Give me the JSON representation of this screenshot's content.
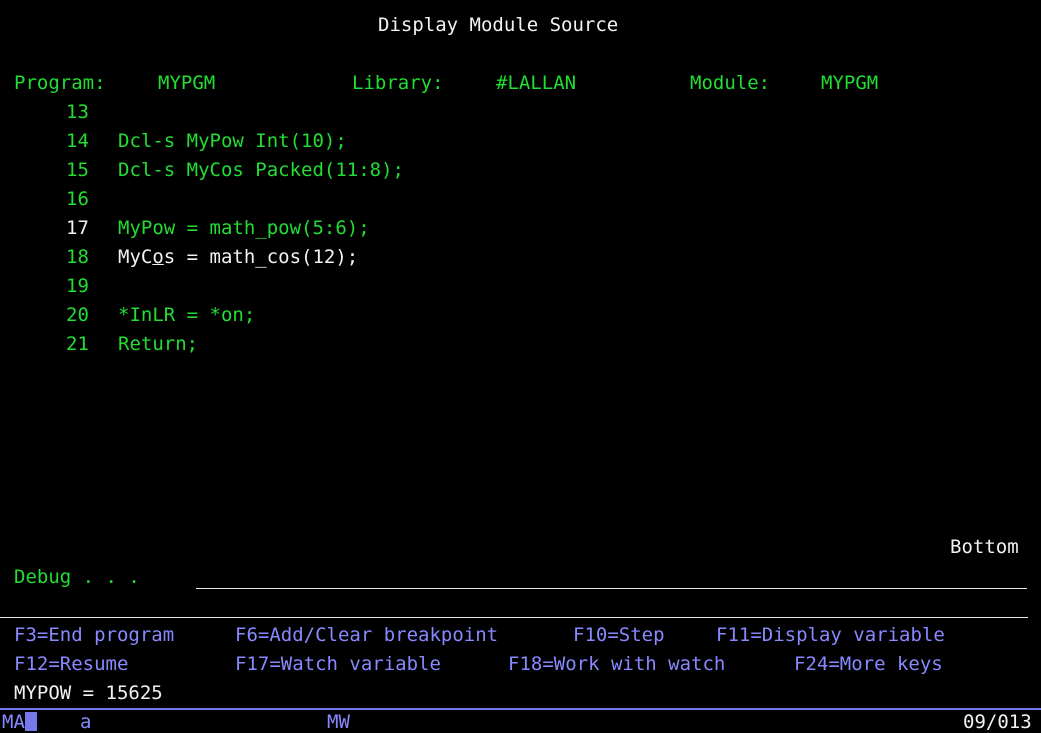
{
  "screen": {
    "title": "Display Module Source"
  },
  "header": {
    "program_label": "Program:",
    "program_value": "MYPGM",
    "library_label": "Library:",
    "library_value": "#LALLAN",
    "module_label": "Module:",
    "module_value": "MYPGM"
  },
  "source": {
    "lines": [
      {
        "num": "13",
        "code": ""
      },
      {
        "num": "14",
        "code": "Dcl-s MyPow Int(10);"
      },
      {
        "num": "15",
        "code": "Dcl-s MyCos Packed(11:8);"
      },
      {
        "num": "16",
        "code": ""
      },
      {
        "num": "17",
        "code": "MyPow = math_pow(5:6);"
      },
      {
        "num": "18",
        "code_pre": "MyC",
        "code_mid": "o",
        "code_post": "s = math_cos(12);"
      },
      {
        "num": "19",
        "code": ""
      },
      {
        "num": "20",
        "code": "*InLR = *on;"
      },
      {
        "num": "21",
        "code": "Return;"
      }
    ],
    "position": "Bottom"
  },
  "debug": {
    "label": "Debug . . .",
    "value": ""
  },
  "function_keys": {
    "f3": "F3=End program",
    "f6": "F6=Add/Clear breakpoint",
    "f10": "F10=Step",
    "f11": "F11=Display variable",
    "f12": "F12=Resume",
    "f17": "F17=Watch variable",
    "f18": "F18=Work with watch",
    "f24": "F24=More keys"
  },
  "message": "MYPOW = 15625",
  "status_bar": {
    "indicator": "MA",
    "mode": "a",
    "workstation": "MW",
    "cursor_pos": "09/013"
  },
  "colors": {
    "background": "#000000",
    "green": "#22dd33",
    "white": "#f2f2f2",
    "blue": "#8888ff"
  }
}
